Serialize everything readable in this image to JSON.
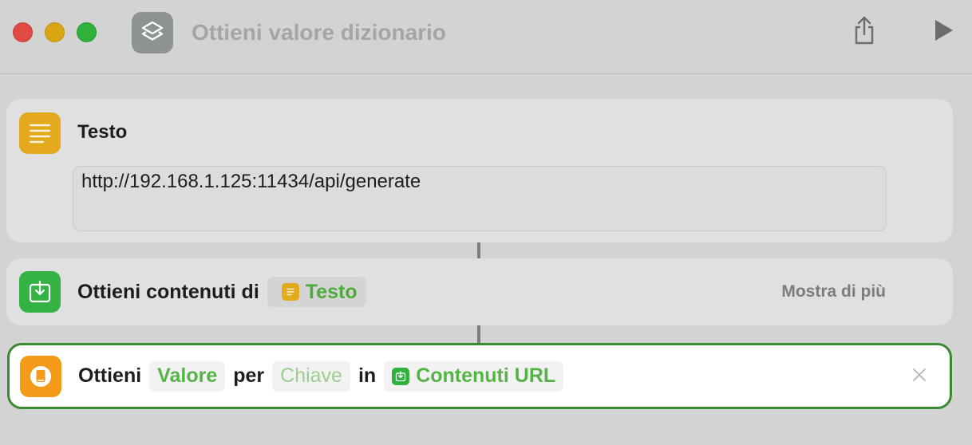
{
  "window": {
    "title": "Ottieni valore dizionario",
    "share_icon": "share-icon",
    "run_icon": "play-icon"
  },
  "colors": {
    "accent_green": "#3a8a32",
    "token_green": "#56b447",
    "text_icon": "#e2aa1c",
    "fetch_icon": "#34b344",
    "dict_icon": "#f49a19"
  },
  "actions": {
    "text": {
      "icon": "text-lines-icon",
      "title": "Testo",
      "value": "http://192.168.1.125:11434/api/generate"
    },
    "fetch": {
      "icon": "download-tray-icon",
      "label": "Ottieni contenuti di",
      "variable": "Testo",
      "more": "Mostra di più"
    },
    "dictionary": {
      "icon": "dictionary-icon",
      "verb": "Ottieni",
      "value_token": "Valore",
      "per": "per",
      "key_placeholder": "Chiave",
      "in": "in",
      "source_token": "Contenuti URL"
    }
  }
}
